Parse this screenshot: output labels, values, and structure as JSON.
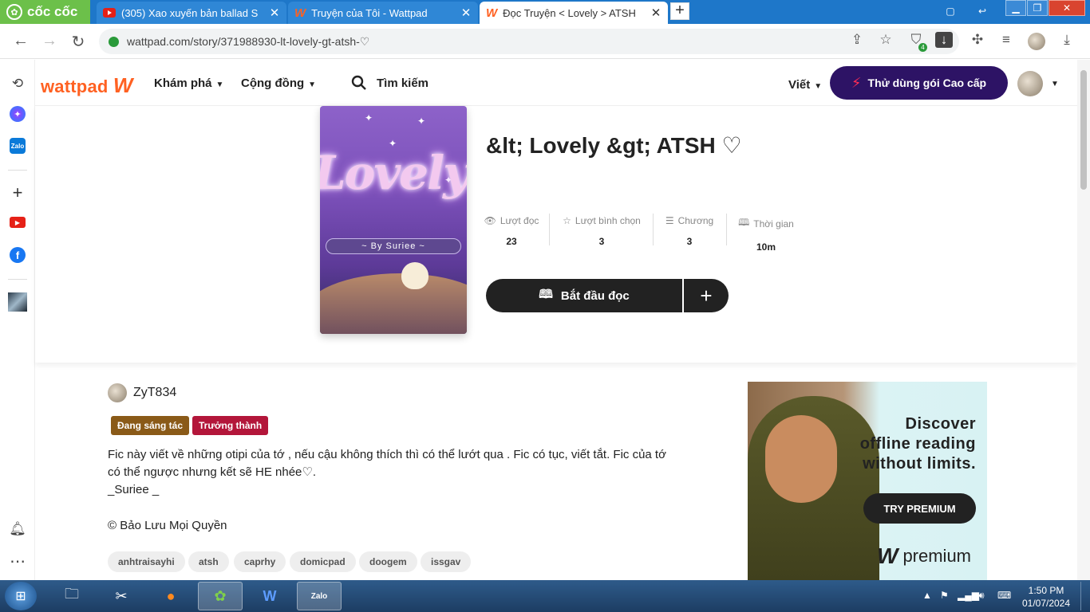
{
  "browser": {
    "brand": "cốc cốc",
    "tabs": [
      {
        "title": "(305) Xao xuyến bản ballad S",
        "active": false
      },
      {
        "title": "Truyện của Tôi - Wattpad",
        "active": false
      },
      {
        "title": "Đọc Truyện < Lovely > ATSH",
        "active": true
      }
    ],
    "url": "wattpad.com/story/371988930-lt-lovely-gt-atsh-♡",
    "extension_badge": "4"
  },
  "header": {
    "logo_text": "wattpad",
    "discover_label": "Khám phá",
    "community_label": "Cộng đồng",
    "search_label": "Tìm kiếm",
    "write_label": "Viết",
    "premium_label": "Thử dùng gói Cao cấp"
  },
  "story": {
    "title": "&lt; Lovely &gt; ATSH ♡",
    "cover_word": "Lovely",
    "cover_byline": "~ By Suriee ~",
    "stats": [
      {
        "label": "Lượt đọc",
        "value": "23",
        "icon": "eye-icon"
      },
      {
        "label": "Lượt bình chọn",
        "value": "3",
        "icon": "star-icon"
      },
      {
        "label": "Chương",
        "value": "3",
        "icon": "list-icon"
      },
      {
        "label": "Thời gian",
        "value": "10m",
        "icon": "book-icon"
      }
    ],
    "read_label": "Bắt đầu đọc",
    "author": "ZyT834",
    "badges": [
      {
        "label": "Đang sáng tác",
        "color": "#8a5a18"
      },
      {
        "label": "Trưởng thành",
        "color": "#b3163a"
      }
    ],
    "description": [
      "Fic này viết về những otipi của tớ , nếu cậu không thích thì có thể lướt qua . Fic có tục, viết tắt. Fic của tớ",
      "có thể ngược nhưng kết sẽ HE nhée♡.",
      "_Suriee _"
    ],
    "copyright": "© Bảo Lưu Mọi Quyền",
    "tags": [
      "anhtraisayhi",
      "atsh",
      "caprhy",
      "domicpad",
      "doogem",
      "issgav"
    ]
  },
  "ad": {
    "line1": "Discover",
    "line2": "offline reading",
    "line3": "without limits.",
    "cta": "TRY PREMIUM",
    "brand": "premium"
  },
  "taskbar": {
    "time": "1:50 PM",
    "date": "01/07/2024"
  },
  "colors": {
    "wattpad_orange": "#ff6122",
    "premium_purple": "#2d1365",
    "titlebar_blue": "#1e77c9"
  }
}
